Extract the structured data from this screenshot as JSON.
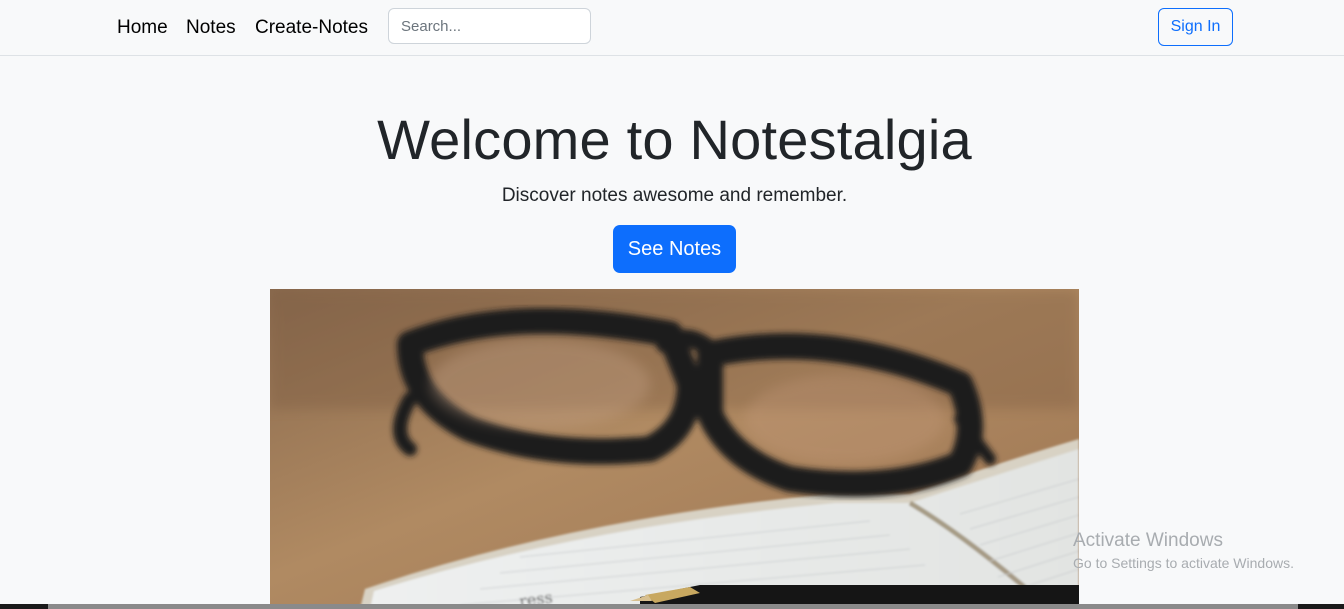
{
  "nav": {
    "links": [
      "Home",
      "Notes",
      "Create-Notes"
    ],
    "search_placeholder": "Search...",
    "signin_label": "Sign In"
  },
  "hero": {
    "title": "Welcome to Notestalgia",
    "subtitle": "Discover notes awesome and remember.",
    "button_label": "See Notes"
  },
  "watermark": {
    "line1": "Activate Windows",
    "line2": "Go to Settings to activate Windows."
  },
  "colors": {
    "primary": "#0d6efd",
    "background": "#f8f9fa",
    "text": "#212529"
  }
}
